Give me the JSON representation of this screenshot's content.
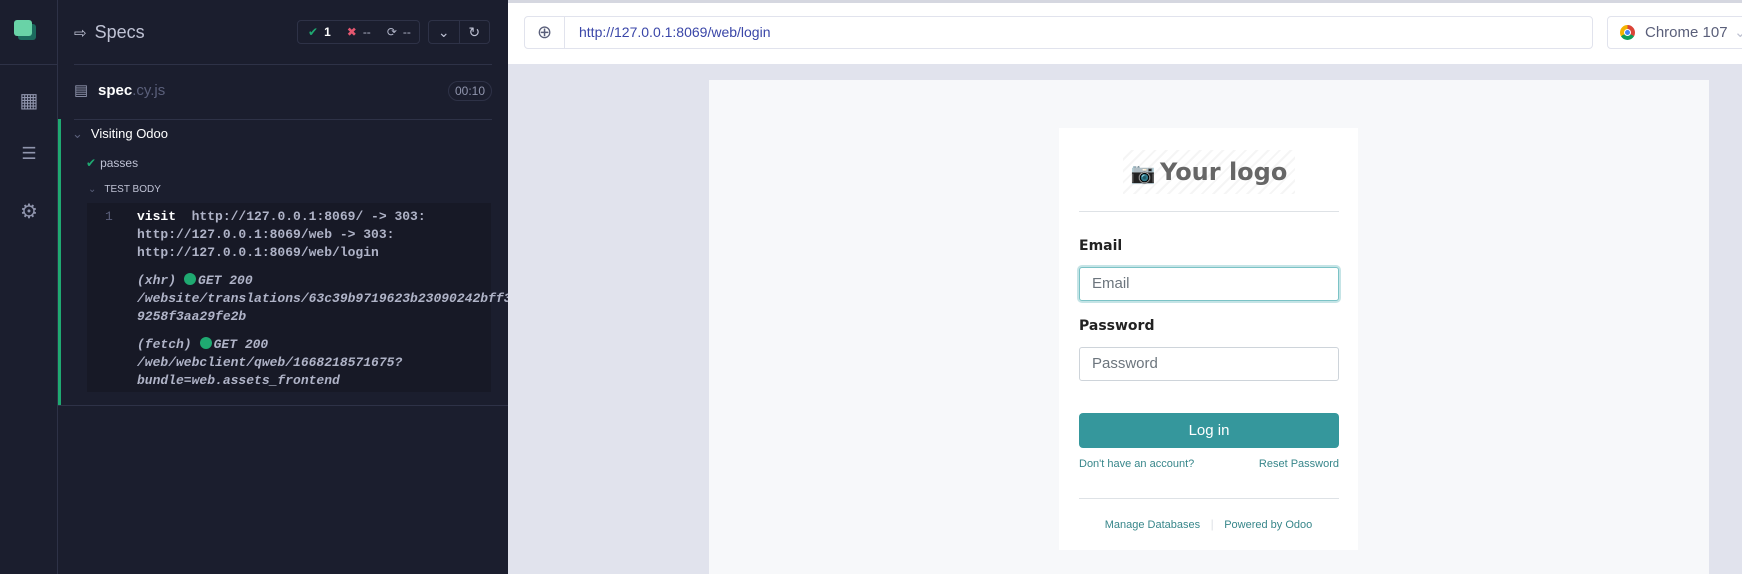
{
  "iconbar": {
    "icons": [
      "cypress-logo-icon",
      "browser-code-icon",
      "specs-list-icon",
      "settings-gear-icon"
    ]
  },
  "sidebar": {
    "title": "Specs",
    "stats": {
      "passed": "1",
      "failed": "--",
      "pending": "--"
    },
    "spec": {
      "name": "spec",
      "ext": ".cy.js",
      "duration": "00:10"
    },
    "suite": "Visiting Odoo",
    "test": "passes",
    "section": "TEST BODY",
    "commands": {
      "number": "1",
      "visit_name": "visit",
      "visit_lines": [
        "http://127.0.0.1:8069/ -> 303:",
        "http://127.0.0.1:8069/web -> 303:",
        "http://127.0.0.1:8069/web/login"
      ],
      "xhr": {
        "type": "(xhr)",
        "status": "GET 200",
        "lines": [
          "/website/translations/63c39b9719623b23090242bff3",
          "9258f3aa29fe2b"
        ]
      },
      "fetch": {
        "type": "(fetch)",
        "status": "GET 200",
        "lines": [
          "/web/webclient/qweb/1668218571675?",
          "bundle=web.assets_frontend"
        ]
      }
    },
    "colors": {
      "pass": "#1fa971",
      "fail": "#e45770"
    }
  },
  "browser": {
    "url": "http://127.0.0.1:8069/web/login",
    "name": "Chrome 107"
  },
  "login": {
    "logo_text": "Your logo",
    "email_label": "Email",
    "email_placeholder": "Email",
    "password_label": "Password",
    "password_placeholder": "Password",
    "login_button": "Log in",
    "signup_link": "Don't have an account?",
    "reset_link": "Reset Password",
    "manage_db": "Manage Databases",
    "powered_by": "Powered by Odoo",
    "accent": "#35979c"
  }
}
